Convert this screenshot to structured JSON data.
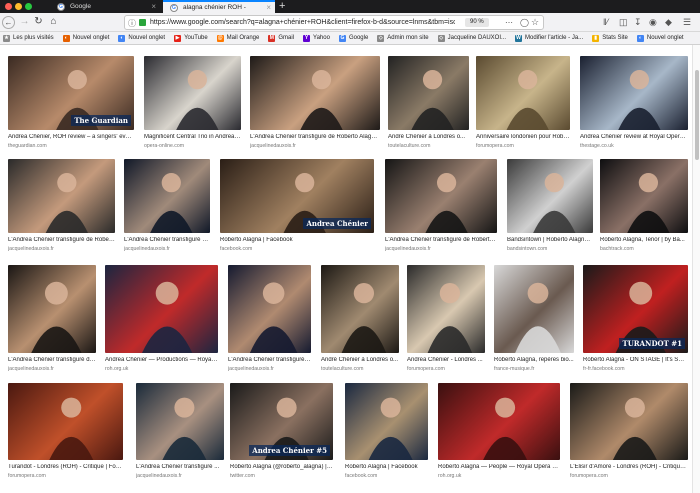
{
  "tabs": [
    {
      "title": "Google",
      "close": "×"
    },
    {
      "title": "alagna chénier ROH - Recherche",
      "close": "×"
    }
  ],
  "new_tab": "+",
  "nav": {
    "url": "https://www.google.com/search?q=alagna+chénier+ROH&client=firefox-b-d&source=lnms&tbm=isch",
    "zoom": "90 %"
  },
  "bookmarks": [
    {
      "label": "Les plus visités",
      "color": "#8a8a8a"
    },
    {
      "label": "Nouvel onglet",
      "color": "#e66000"
    },
    {
      "label": "Nouvel onglet",
      "color": "#4285f4"
    },
    {
      "label": "YouTube",
      "color": "#e62117"
    },
    {
      "label": "Mail Orange",
      "color": "#ff7900"
    },
    {
      "label": "Gmail",
      "color": "#d93025"
    },
    {
      "label": "Yahoo",
      "color": "#6001d2"
    },
    {
      "label": "Google",
      "color": "#4285f4"
    },
    {
      "label": "Admin mon site",
      "color": "#888888"
    },
    {
      "label": "Jacqueline DAUXOI...",
      "color": "#888888"
    },
    {
      "label": "Modifier l'article - Ja...",
      "color": "#21759b"
    },
    {
      "label": "Stats Site",
      "color": "#f4b400"
    },
    {
      "label": "Nouvel onglet",
      "color": "#4285f4"
    }
  ],
  "results": [
    {
      "caption": "Andrea Chénier, ROH review – a singers' eveni...",
      "source": "theguardian.com",
      "c1": "#3a2a22",
      "c2": "#b78a6a",
      "badge": "The Guardian"
    },
    {
      "caption": "Magnificent Central Trio in Andrea ...",
      "source": "opera-online.com",
      "c1": "#2a2a30",
      "c2": "#d8d4cc"
    },
    {
      "caption": "L'Andrea Chénier transfiguré de Roberto Alagna ...",
      "source": "jacquelinedauxois.fr",
      "c1": "#1e1a18",
      "c2": "#c9a080"
    },
    {
      "caption": "André Chénier à Londres o...",
      "source": "toutelaculture.com",
      "c1": "#222222",
      "c2": "#8a7a66"
    },
    {
      "caption": "Anniversaire londonien pour Robert...",
      "source": "forumopera.com",
      "c1": "#5a4a30",
      "c2": "#c7b48a"
    },
    {
      "caption": "Andrea Chénier review at Royal Opera ...",
      "source": "thestage.co.uk",
      "c1": "#1a2030",
      "c2": "#a7b7c8"
    },
    {
      "caption": "L'Andrea Chénier transfiguré de Robert...",
      "source": "jacquelinedauxois.fr",
      "c1": "#2a2a2a",
      "c2": "#c49a7c"
    },
    {
      "caption": "L'Andrea Chénier transfiguré d...",
      "source": "jacquelinedauxois.fr",
      "c1": "#101828",
      "c2": "#a08a7a"
    },
    {
      "caption": "Roberto Alagna | Facebook",
      "source": "facebook.com",
      "c1": "#2a1e16",
      "c2": "#a08060",
      "badge": "Andrea Chénier"
    },
    {
      "caption": "L'Andrea Chénier transfiguré de Roberto ...",
      "source": "jacquelinedauxois.fr",
      "c1": "#151515",
      "c2": "#9a8070"
    },
    {
      "caption": "Bandsintown | Roberto Alagna ...",
      "source": "bandsintown.com",
      "c1": "#3a3a3a",
      "c2": "#d0d0d0"
    },
    {
      "caption": "Roberto Alagna, Tenor | by Ba...",
      "source": "bachtrack.com",
      "c1": "#0e0e10",
      "c2": "#8a7066"
    },
    {
      "caption": "L'Andrea Chénier transfiguré de ...",
      "source": "jacquelinedauxois.fr",
      "c1": "#1a1614",
      "c2": "#b89070"
    },
    {
      "caption": "Andrea Chénier — Productions — Royal O...",
      "source": "roh.org.uk",
      "c1": "#1c2540",
      "c2": "#c02a2a"
    },
    {
      "caption": "L'Andrea Chénier transfiguré de ...",
      "source": "jacquelinedauxois.fr",
      "c1": "#151a30",
      "c2": "#b08a70"
    },
    {
      "caption": "André Chénier à Londres o...",
      "source": "toutelaculture.com",
      "c1": "#1c1814",
      "c2": "#a08a70"
    },
    {
      "caption": "Andrea Chénier - Londres ...",
      "source": "forumopera.com",
      "c1": "#2a2a2a",
      "c2": "#d8c8b0"
    },
    {
      "caption": "Roberto Alagna, repères bio...",
      "source": "france-musique.fr",
      "c1": "#d8d8d8",
      "c2": "#6a5a50"
    },
    {
      "caption": "Roberto Alagna - ON STAGE | It's Sm...",
      "source": "fr-fr.facebook.com",
      "c1": "#1a1a1a",
      "c2": "#c02020",
      "badge": "TURANDOT #1"
    },
    {
      "caption": "Turandot - Londres (ROH) - Critique | Forum...",
      "source": "forumopera.com",
      "c1": "#4a1810",
      "c2": "#c0502a"
    },
    {
      "caption": "L'Andrea Chénier transfiguré ...",
      "source": "jacquelinedauxois.fr",
      "c1": "#1a2a3a",
      "c2": "#a89080"
    },
    {
      "caption": "Roberto Alagna (@roberto_alagna) | T...",
      "source": "twitter.com",
      "c1": "#1a1a1a",
      "c2": "#8a7060",
      "badge": "Andrea Chénier #5"
    },
    {
      "caption": "Roberto Alagna | Facebook",
      "source": "facebook.com",
      "c1": "#1a2840",
      "c2": "#a89070"
    },
    {
      "caption": "Roberto Alagna — People — Royal Opera Ho...",
      "source": "roh.org.uk",
      "c1": "#3a1010",
      "c2": "#c02a2a"
    },
    {
      "caption": "L'Elisir d'Amore - Londres (ROH) - Critique |...",
      "source": "forumopera.com",
      "c1": "#1a1a18",
      "c2": "#b08a6a"
    }
  ]
}
